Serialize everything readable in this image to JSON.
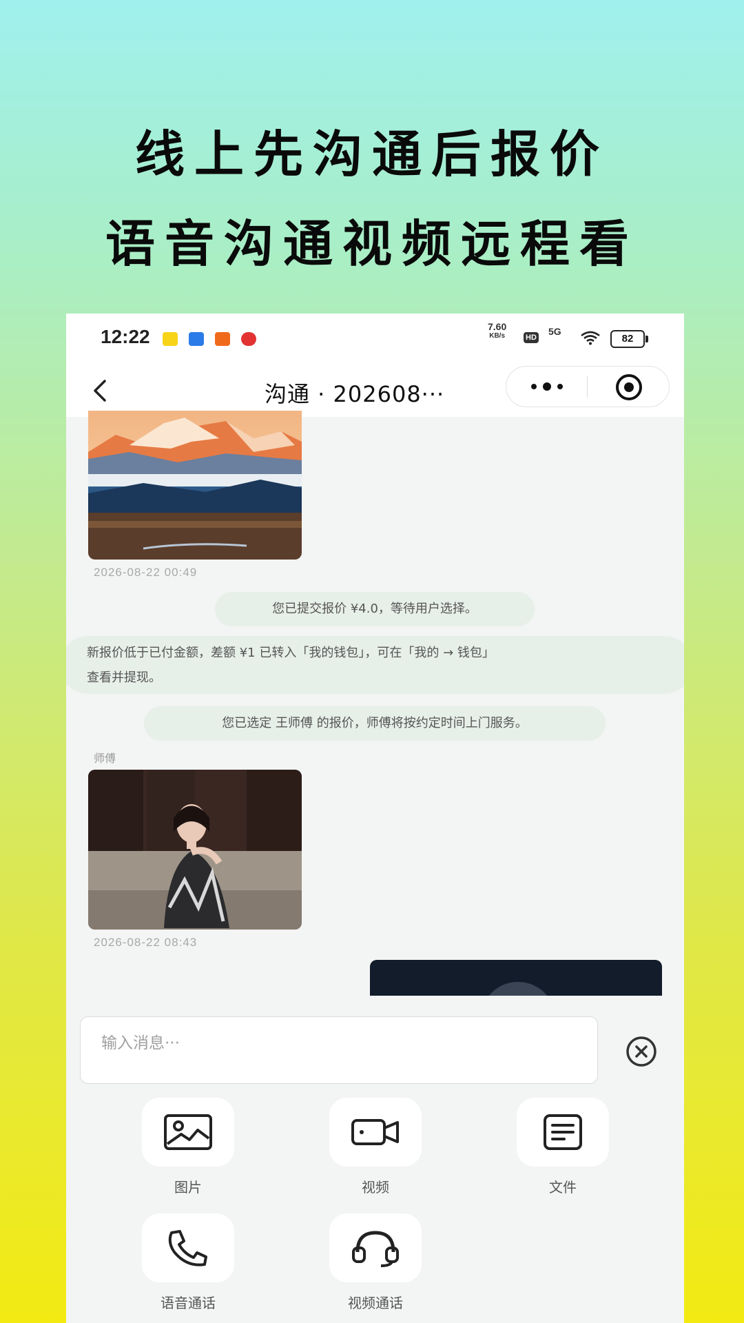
{
  "promo": {
    "headline1": "线上先沟通后报价",
    "headline2": "语音沟通视频远程看"
  },
  "statusbar": {
    "time": "12:22",
    "net_speed_value": "7.60",
    "net_speed_unit": "KB/s",
    "hd": "HD",
    "network": "5G",
    "battery": "82"
  },
  "navbar": {
    "title": "沟通 · 202608···"
  },
  "messages": {
    "image1_time": "2026-08-22 00:49",
    "system1": "您已提交报价 ¥4.0，等待用户选择。",
    "system2_line1": "新报价低于已付金额，差额 ¥1 已转入「我的钱包」，可在「我的 → 钱包」",
    "system2_line2": "查看并提现。",
    "system3": "您已选定 王师傅 的报价，师傅将按约定时间上门服务。",
    "sender_label": "师傅",
    "image2_time": "2026-08-22 08:43"
  },
  "input": {
    "placeholder": "输入消息···"
  },
  "tools": [
    {
      "label": "图片",
      "icon": "image-icon"
    },
    {
      "label": "视频",
      "icon": "video-icon"
    },
    {
      "label": "文件",
      "icon": "file-icon"
    },
    {
      "label": "语音通话",
      "icon": "phone-icon"
    },
    {
      "label": "视频通话",
      "icon": "headset-icon"
    }
  ]
}
